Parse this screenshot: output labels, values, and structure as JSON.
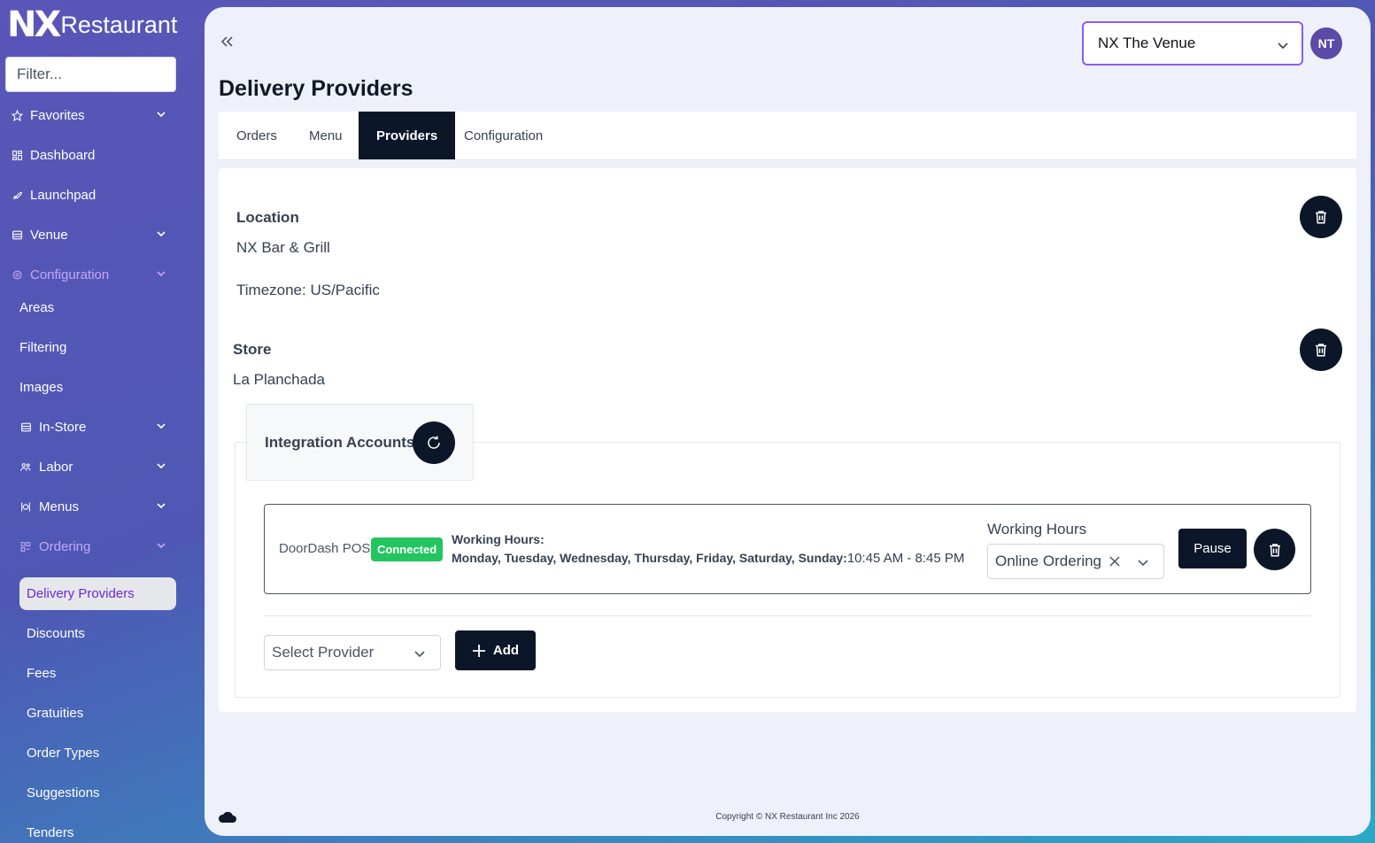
{
  "app": {
    "logo_mark": "NX",
    "logo_text": "Restaurant"
  },
  "sidebar": {
    "filter_placeholder": "Filter...",
    "items": {
      "favorites": "Favorites",
      "dashboard": "Dashboard",
      "launchpad": "Launchpad",
      "venue": "Venue",
      "configuration": "Configuration",
      "areas": "Areas",
      "filtering": "Filtering",
      "images": "Images",
      "in_store": "In-Store",
      "labor": "Labor",
      "menus": "Menus",
      "ordering": "Ordering",
      "delivery_providers": "Delivery Providers",
      "discounts": "Discounts",
      "fees": "Fees",
      "gratuities": "Gratuities",
      "order_types": "Order Types",
      "suggestions": "Suggestions",
      "tenders": "Tenders"
    },
    "active_color": "#c4a8f5",
    "selected_color": "#6d28d9"
  },
  "header": {
    "venue_selected": "NX The Venue",
    "avatar_initials": "NT"
  },
  "page": {
    "title": "Delivery Providers",
    "tabs": {
      "orders": "Orders",
      "menu": "Menu",
      "providers": "Providers",
      "configuration": "Configuration"
    },
    "active_tab": "Providers"
  },
  "location": {
    "label": "Location",
    "name": "NX Bar & Grill",
    "timezone": "Timezone: US/Pacific"
  },
  "store": {
    "label": "Store",
    "name": "La Planchada"
  },
  "integration": {
    "title": "Integration Accounts",
    "provider": {
      "name": "DoorDash POS",
      "status": "Connected",
      "status_color": "#22c55e",
      "working_hours_title": "Working Hours:",
      "working_days": "Monday, Tuesday, Wednesday, Thursday, Friday, Saturday, Sunday:",
      "working_time": "10:45 AM - 8:45 PM",
      "working_hours_label": "Working Hours",
      "working_hours_value": "Online Ordering",
      "pause_label": "Pause"
    },
    "select_provider_placeholder": "Select Provider",
    "add_label": "Add"
  },
  "footer": {
    "copyright": "Copyright © NX Restaurant Inc 2026"
  },
  "colors": {
    "dark_button": "#0b1629",
    "focus_border": "#8b5cf6",
    "avatar_bg": "#5b4aa6"
  }
}
